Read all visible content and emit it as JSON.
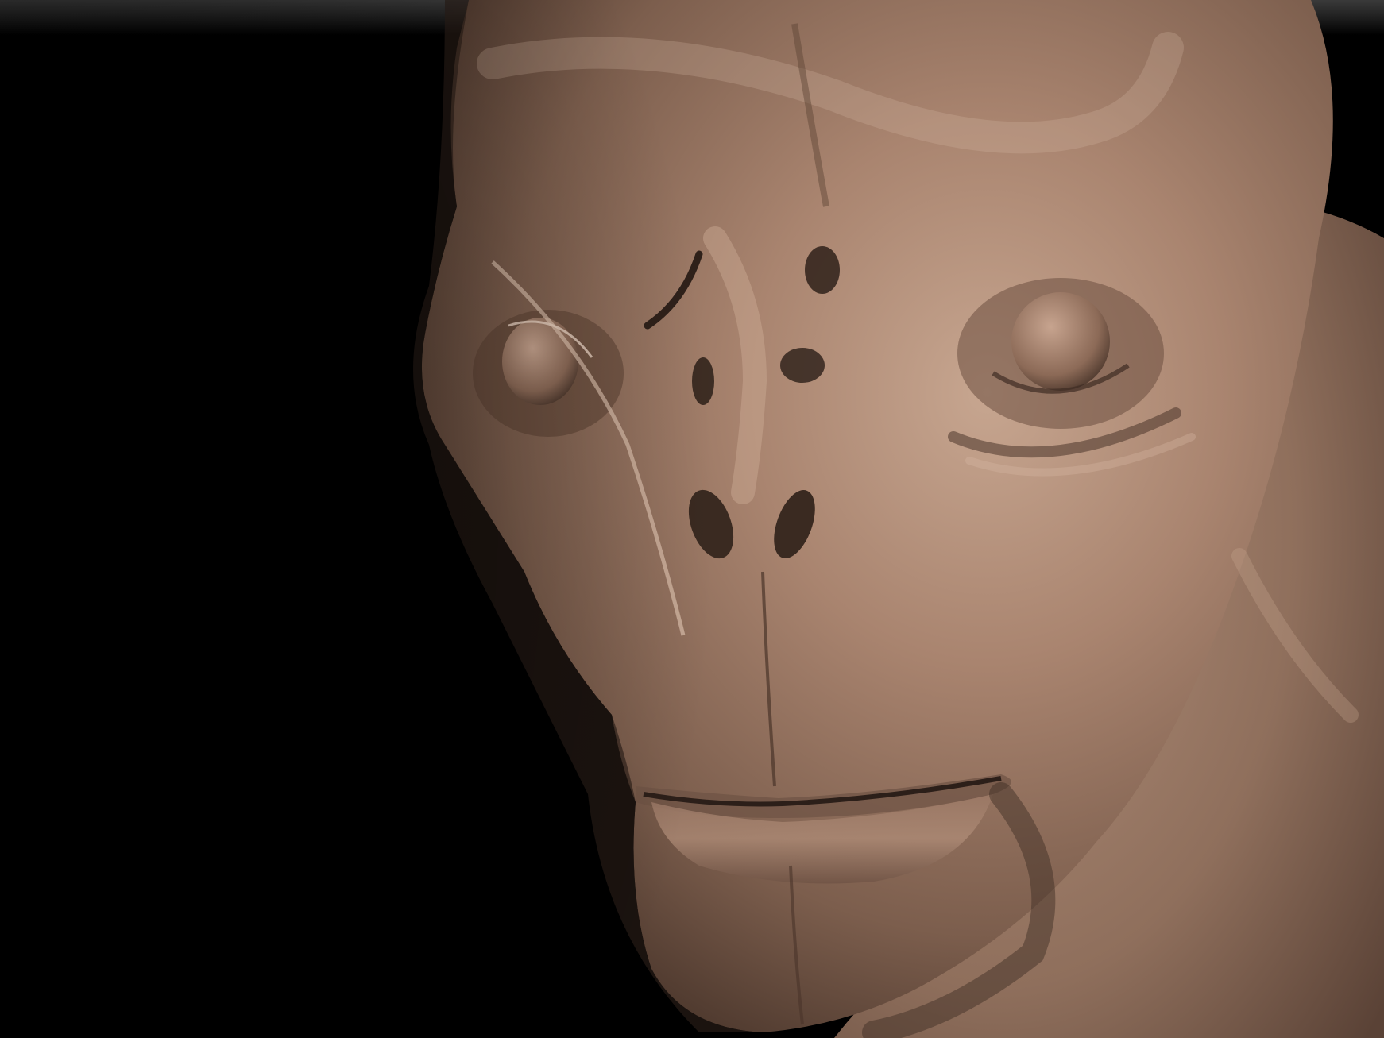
{
  "scene": {
    "subject": "sculpted-alien-head-render",
    "colors": {
      "background": "#000000",
      "skin_base": "#8a6a58",
      "skin_highlight": "#c9a893",
      "skin_shadow": "#3a2a22"
    }
  }
}
